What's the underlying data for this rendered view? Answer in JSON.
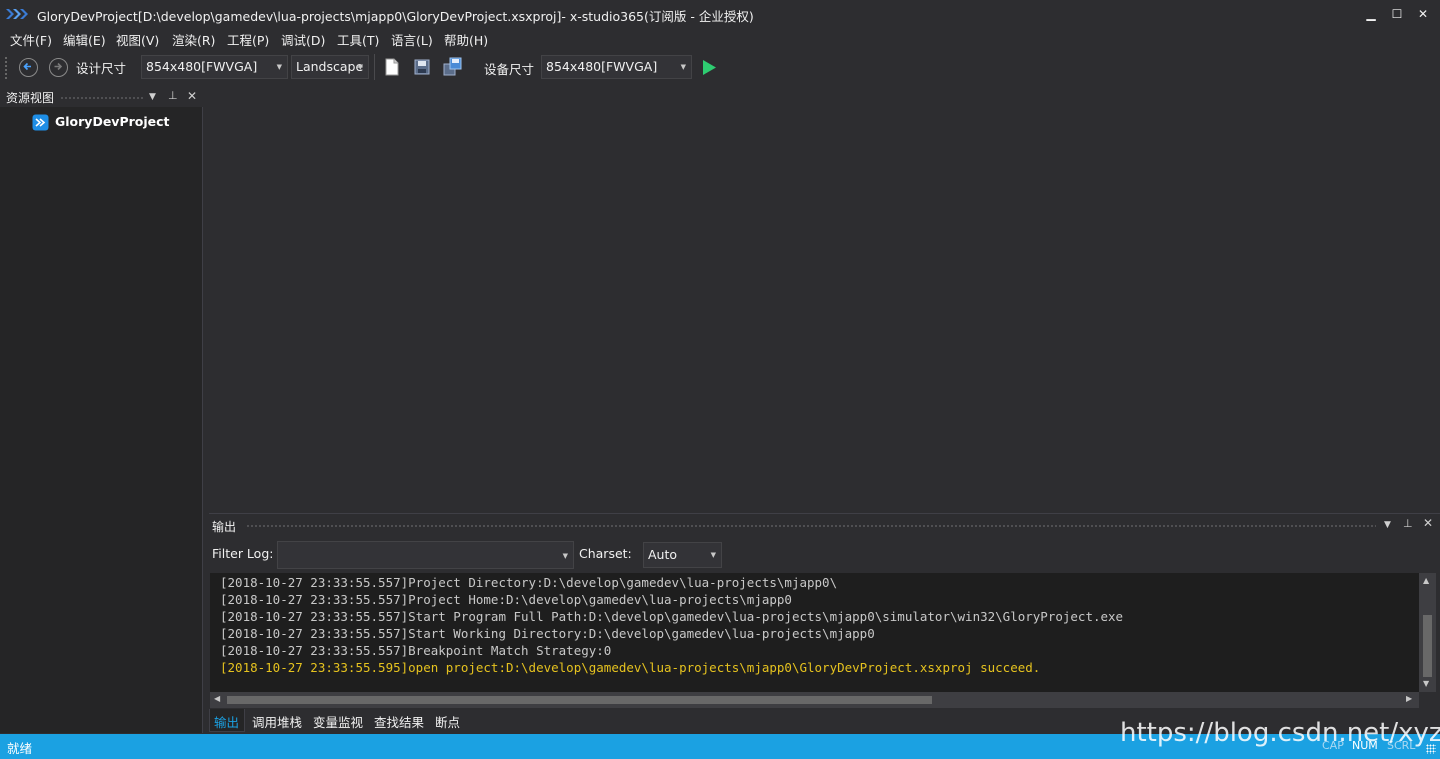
{
  "window": {
    "title": "GloryDevProject[D:\\develop\\gamedev\\lua-projects\\mjapp0\\GloryDevProject.xsxproj]- x-studio365(订阅版 - 企业授权)",
    "minimize": "▁",
    "maximize": "☐",
    "close": "✕"
  },
  "menu": [
    "文件(F)",
    "编辑(E)",
    "视图(V)",
    "渲染(R)",
    "工程(P)",
    "调试(D)",
    "工具(T)",
    "语言(L)",
    "帮助(H)"
  ],
  "toolbar": {
    "design_size_label": "设计尺寸",
    "design_size_value": "854x480[FWVGA]",
    "orientation_value": "Landscape",
    "device_size_label": "设备尺寸",
    "device_size_value": "854x480[FWVGA]"
  },
  "left_panel": {
    "title": "资源视图",
    "project_name": "GloryDevProject"
  },
  "output": {
    "title": "输出",
    "filter_label": "Filter Log:",
    "filter_value": "",
    "charset_label": "Charset:",
    "charset_value": "Auto",
    "lines": [
      {
        "text": "[2018-10-27 23:33:55.557]Project Directory:D:\\develop\\gamedev\\lua-projects\\mjapp0\\",
        "color": "#c8c8c8"
      },
      {
        "text": "[2018-10-27 23:33:55.557]Project Home:D:\\develop\\gamedev\\lua-projects\\mjapp0",
        "color": "#c8c8c8"
      },
      {
        "text": "[2018-10-27 23:33:55.557]Start Program Full Path:D:\\develop\\gamedev\\lua-projects\\mjapp0\\simulator\\win32\\GloryProject.exe",
        "color": "#c8c8c8"
      },
      {
        "text": "[2018-10-27 23:33:55.557]Start Working Directory:D:\\develop\\gamedev\\lua-projects\\mjapp0",
        "color": "#c8c8c8"
      },
      {
        "text": "[2018-10-27 23:33:55.557]Breakpoint Match Strategy:0",
        "color": "#c8c8c8"
      },
      {
        "text": "[2018-10-27 23:33:55.595]open project:D:\\develop\\gamedev\\lua-projects\\mjapp0\\GloryDevProject.xsxproj succeed.",
        "color": "#e5c21f"
      }
    ]
  },
  "bottom_tabs": [
    "输出",
    "调用堆栈",
    "变量监视",
    "查找结果",
    "断点"
  ],
  "status": {
    "text": "就绪",
    "indicators": [
      "CAP",
      "NUM",
      "SCRL"
    ]
  },
  "watermark": "https://blog.csdn.net/xyzzf",
  "colors": {
    "accent": "#1ba1e2",
    "background": "#2d2d30",
    "console_bg": "#1e1e1e",
    "success_text": "#e5c21f",
    "run_icon": "#2ecc71"
  }
}
